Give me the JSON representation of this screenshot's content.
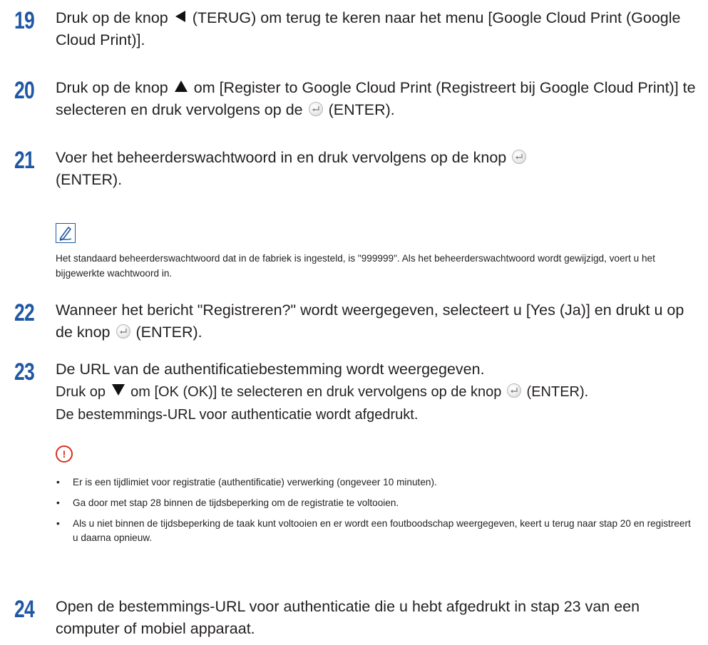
{
  "step19": {
    "num": "19",
    "text_a": "Druk op de knop",
    "text_b": "(TERUG) om terug te keren naar het menu [Google Cloud Print (Google Cloud Print)]."
  },
  "step20": {
    "num": "20",
    "text_a": "Druk op de knop",
    "text_b": "om [Register to Google Cloud Print (Registreert bij Google Cloud Print)] te selecteren en druk vervolgens op de",
    "text_c": "(ENTER)."
  },
  "step21": {
    "num": "21",
    "text_a": "Voer het beheerderswachtwoord in en druk vervolgens op de knop",
    "text_b": "(ENTER)."
  },
  "note": {
    "icon": "memo-pencil-icon",
    "text": "Het standaard beheerderswachtwoord dat in de fabriek is ingesteld, is \"999999\". Als het beheerderswachtwoord wordt gewijzigd, voert u het bijgewerkte wachtwoord in."
  },
  "step22": {
    "num": "22",
    "text_a": "Wanneer het bericht \"Registreren?\" wordt weergegeven, selecteert u [Yes (Ja)] en drukt u op de knop",
    "text_b": "(ENTER)."
  },
  "step23": {
    "num": "23",
    "line1": "De URL van de authentificatiebestemming wordt weergegeven.",
    "text_a": "Druk op",
    "text_b": "om [OK (OK)] te selecteren en druk vervolgens op de knop",
    "text_c": "(ENTER).",
    "line3": "De bestemmings-URL voor authenticatie wordt afgedrukt."
  },
  "caution": {
    "icon": "caution-exclamation-icon",
    "mark": "!",
    "bullet": "•",
    "items": [
      "Er is een tijdlimiet voor registratie (authentificatie) verwerking (ongeveer 10 minuten).",
      "Ga door met stap 28 binnen de tijdsbeperking om de registratie te voltooien.",
      "Als u niet binnen de tijdsbeperking de taak kunt voltooien en er wordt een foutboodschap weergegeven, keert u terug naar stap 20 en registreert u daarna opnieuw."
    ]
  },
  "step24": {
    "num": "24",
    "text": "Open de bestemmings-URL voor authenticatie die u hebt afgedrukt in stap 23 van een computer of mobiel apparaat."
  },
  "colors": {
    "step_number": "#1f57a4",
    "text": "#231f20",
    "caution": "#d92e1f",
    "note_border": "#1f57a4"
  }
}
